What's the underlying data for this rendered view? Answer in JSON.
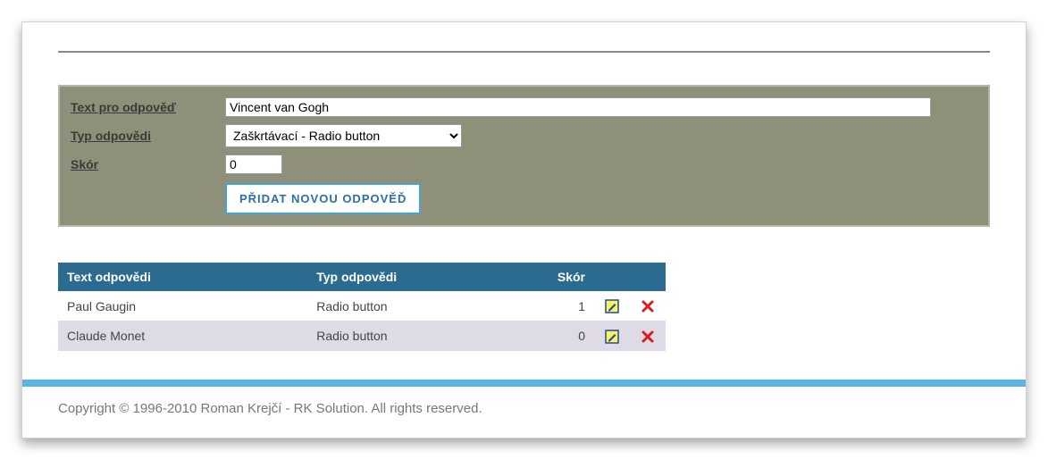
{
  "form": {
    "labels": {
      "answer_text": "Text pro odpověď",
      "answer_type": "Typ odpovědi",
      "score": "Skór"
    },
    "values": {
      "answer_text": "Vincent van Gogh",
      "answer_type": "Zaškrtávací - Radio button",
      "score": "0"
    },
    "submit": "PŘIDAT NOVOU ODPOVĚĎ"
  },
  "table": {
    "headers": {
      "text": "Text odpovědi",
      "type": "Typ odpovědi",
      "score": "Skór"
    },
    "rows": [
      {
        "text": "Paul Gaugin",
        "type": "Radio button",
        "score": "1"
      },
      {
        "text": "Claude Monet",
        "type": "Radio button",
        "score": "0"
      }
    ]
  },
  "footer": {
    "copyright": "Copyright © 1996-2010 Roman Krejčí - RK Solution. All rights reserved."
  }
}
